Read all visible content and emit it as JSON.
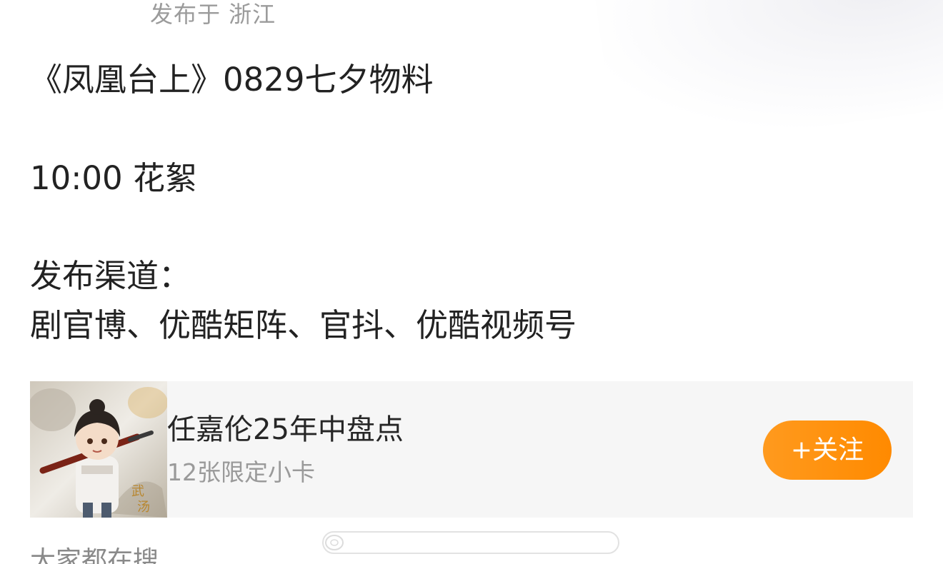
{
  "post": {
    "location_text": "发布于 浙江",
    "lines": [
      "《凤凰台上》0829七夕物料",
      "10:00  花絮",
      "发布渠道：",
      "剧官博、优酷矩阵、官抖、优酷视频号"
    ]
  },
  "promo_card": {
    "title": "任嘉伦25年中盘点",
    "subtitle": "12张限定小卡",
    "follow_label": "+关注",
    "accent_color": "#ff8a00",
    "thumbnail_icon": "chibi-character-card-image"
  },
  "footer": {
    "trending_label": "大家都在搜"
  }
}
